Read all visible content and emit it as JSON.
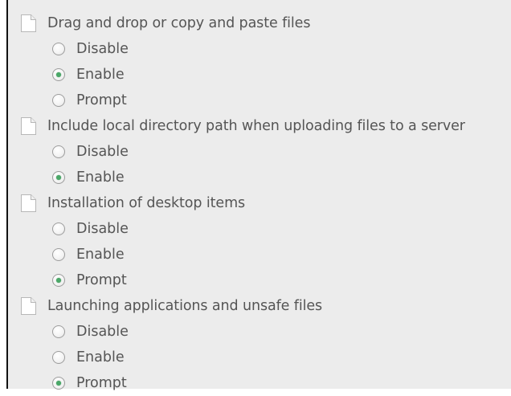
{
  "settings": [
    {
      "title": "Drag and drop or copy and paste files",
      "options": [
        {
          "label": "Disable",
          "checked": false
        },
        {
          "label": "Enable",
          "checked": true
        },
        {
          "label": "Prompt",
          "checked": false
        }
      ]
    },
    {
      "title": "Include local directory path when uploading files to a server",
      "options": [
        {
          "label": "Disable",
          "checked": false
        },
        {
          "label": "Enable",
          "checked": true
        }
      ]
    },
    {
      "title": "Installation of desktop items",
      "options": [
        {
          "label": "Disable",
          "checked": false
        },
        {
          "label": "Enable",
          "checked": false
        },
        {
          "label": "Prompt",
          "checked": true
        }
      ]
    },
    {
      "title": "Launching applications and unsafe files",
      "options": [
        {
          "label": "Disable",
          "checked": false
        },
        {
          "label": "Enable",
          "checked": false
        },
        {
          "label": "Prompt",
          "checked": true
        }
      ]
    }
  ],
  "icons": {
    "setting": "document-icon",
    "option": "radio-button-icon"
  }
}
